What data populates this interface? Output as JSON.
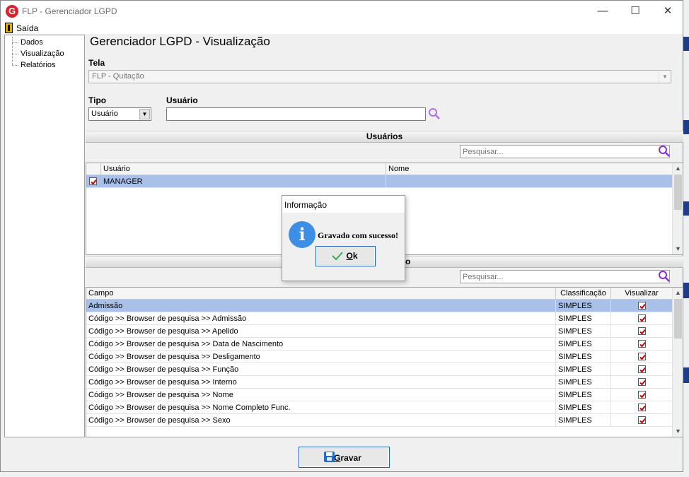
{
  "window": {
    "title": "FLP - Gerenciador LGPD",
    "app_logo": "G"
  },
  "window_controls": {
    "minimize": "—",
    "maximize": "☐",
    "close": "✕"
  },
  "menu": {
    "exit": "Saída"
  },
  "tree": {
    "items": [
      "Dados",
      "Visualização",
      "Relatórios"
    ]
  },
  "page": {
    "title": "Gerenciador LGPD - Visualização"
  },
  "form": {
    "tela_label": "Tela",
    "tela_value": "FLP - Quitação",
    "tipo_label": "Tipo",
    "tipo_value": "Usuário",
    "usuario_label": "Usuário",
    "usuario_value": ""
  },
  "usuarios": {
    "header": "Usuários",
    "search_placeholder": "Pesquisar...",
    "columns": [
      "Usuário",
      "Nome"
    ],
    "rows": [
      {
        "checked": true,
        "usuario": "MANAGER",
        "nome": ""
      }
    ]
  },
  "campos": {
    "header": "o",
    "search_placeholder": "Pesquisar...",
    "columns": [
      "Campo",
      "Classificação",
      "Visualizar"
    ],
    "rows": [
      {
        "campo": "Admissão",
        "classificacao": "SIMPLES",
        "visualizar": true
      },
      {
        "campo": "Código >> Browser de pesquisa >> Admissão",
        "classificacao": "SIMPLES",
        "visualizar": true
      },
      {
        "campo": "Código >> Browser de pesquisa >> Apelido",
        "classificacao": "SIMPLES",
        "visualizar": true
      },
      {
        "campo": "Código >> Browser de pesquisa >> Data de Nascimento",
        "classificacao": "SIMPLES",
        "visualizar": true
      },
      {
        "campo": "Código >> Browser de pesquisa >> Desligamento",
        "classificacao": "SIMPLES",
        "visualizar": true
      },
      {
        "campo": "Código >> Browser de pesquisa >> Função",
        "classificacao": "SIMPLES",
        "visualizar": true
      },
      {
        "campo": "Código >> Browser de pesquisa >> Interno",
        "classificacao": "SIMPLES",
        "visualizar": true
      },
      {
        "campo": "Código >> Browser de pesquisa >> Nome",
        "classificacao": "SIMPLES",
        "visualizar": true
      },
      {
        "campo": "Código >> Browser de pesquisa >> Nome Completo Func.",
        "classificacao": "SIMPLES",
        "visualizar": true
      },
      {
        "campo": "Código >> Browser de pesquisa >> Sexo",
        "classificacao": "SIMPLES",
        "visualizar": true
      }
    ]
  },
  "buttons": {
    "gravar_first": "G",
    "gravar_rest": "ravar"
  },
  "dialog": {
    "title": "Informação",
    "icon_glyph": "i",
    "message": "Gravado com sucesso!",
    "ok_first": "O",
    "ok_rest": "k"
  },
  "colors": {
    "selection": "#a9c1e9",
    "accent_blue": "#1d5fb6",
    "check_red": "#cc0000",
    "search_purple": "#8a2be2"
  }
}
